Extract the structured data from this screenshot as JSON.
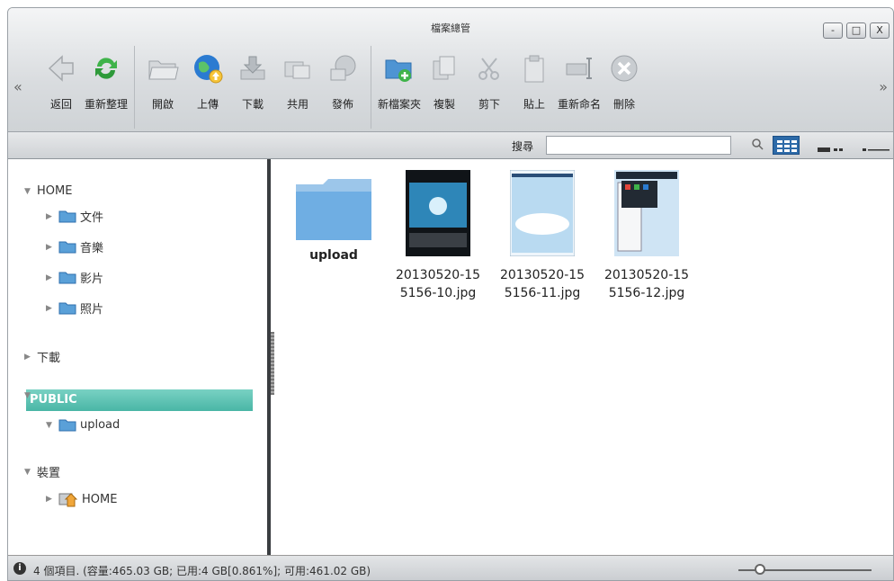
{
  "window": {
    "title": "檔案總管",
    "minimize": "-",
    "restore": "□",
    "close": "X"
  },
  "nav": {
    "left": "«",
    "right": "»"
  },
  "toolbar": {
    "back": "返回",
    "refresh": "重新整理",
    "open": "開啟",
    "upload": "上傳",
    "download": "下載",
    "share": "共用",
    "publish": "發佈",
    "new_folder": "新檔案夾",
    "copy": "複製",
    "cut": "剪下",
    "paste": "貼上",
    "rename": "重新命名",
    "delete": "刪除"
  },
  "search": {
    "label": "搜尋",
    "value": ""
  },
  "sidebar": {
    "home": "HOME",
    "documents": "文件",
    "music": "音樂",
    "videos": "影片",
    "photos": "照片",
    "downloads": "下載",
    "public": "PUBLIC",
    "public_upload": "upload",
    "devices": "裝置",
    "device_home": "HOME"
  },
  "files": [
    {
      "name": "upload"
    },
    {
      "name_line1": "20130520-15",
      "name_line2": "5156-10.jpg"
    },
    {
      "name_line1": "20130520-15",
      "name_line2": "5156-11.jpg"
    },
    {
      "name_line1": "20130520-15",
      "name_line2": "5156-12.jpg"
    }
  ],
  "status": {
    "text": "4 個項目. (容量:465.03 GB; 已用:4 GB[0.861%]; 可用:461.02 GB)",
    "info_icon": "i"
  },
  "colors": {
    "selection": "#49b6a6",
    "view_active": "#2d6aa8",
    "folder": "#5aa0d8"
  }
}
